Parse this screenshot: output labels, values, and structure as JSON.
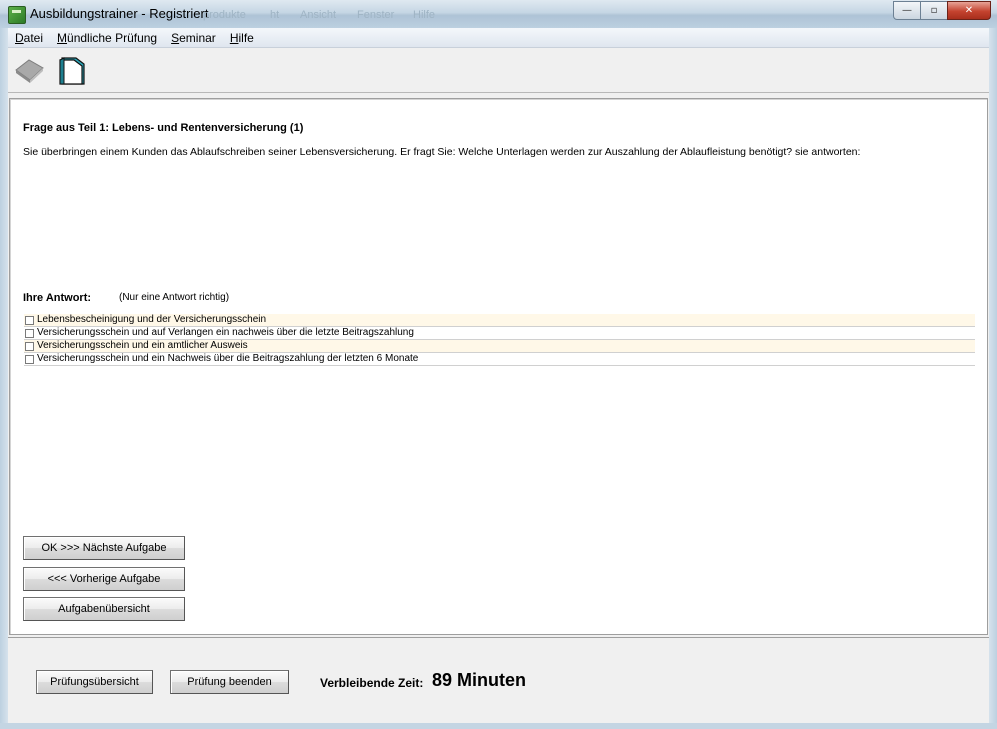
{
  "window": {
    "title": "Ausbildungstrainer - Registriert",
    "ghost_menu": [
      "produkte",
      "ht",
      "Ansicht",
      "Fenster",
      "Hilfe"
    ],
    "minimize": "—",
    "maximize": "▫",
    "close": "✕"
  },
  "menubar": {
    "items": [
      {
        "acc": "D",
        "rest": "atei"
      },
      {
        "acc": "M",
        "rest": "ündliche Prüfung"
      },
      {
        "acc": "S",
        "rest": "eminar"
      },
      {
        "acc": "H",
        "rest": "ilfe"
      }
    ]
  },
  "toolbar": {
    "icons": [
      "book-icon",
      "folder-icon"
    ]
  },
  "question": {
    "title": "Frage aus Teil 1: Lebens- und Rentenversicherung (1)",
    "text": "Sie überbringen einem Kunden das Ablaufschreiben seiner Lebensversicherung. Er fragt Sie: Welche Unterlagen werden zur Auszahlung der Ablaufleistung benötigt? sie antworten:"
  },
  "answer": {
    "label": "Ihre Antwort:",
    "hint": "(Nur eine Antwort richtig)",
    "options": [
      {
        "label": "Lebensbescheinigung und der Versicherungsschein",
        "checked": false
      },
      {
        "label": "Versicherungsschein und auf Verlangen ein nachweis über die letzte Beitragszahlung",
        "checked": false
      },
      {
        "label": "Versicherungsschein und ein amtlicher Ausweis",
        "checked": false
      },
      {
        "label": "Versicherungsschein und ein Nachweis über die Beitragszahlung der letzten 6 Monate",
        "checked": false
      }
    ]
  },
  "buttons": {
    "next": "OK >>> Nächste Aufgabe",
    "prev": "<<< Vorherige Aufgabe",
    "overview": "Aufgabenübersicht",
    "exam_overview": "Prüfungsübersicht",
    "exam_end": "Prüfung beenden"
  },
  "timer": {
    "label": "Verbleibende Zeit:",
    "value": "89 Minuten"
  }
}
